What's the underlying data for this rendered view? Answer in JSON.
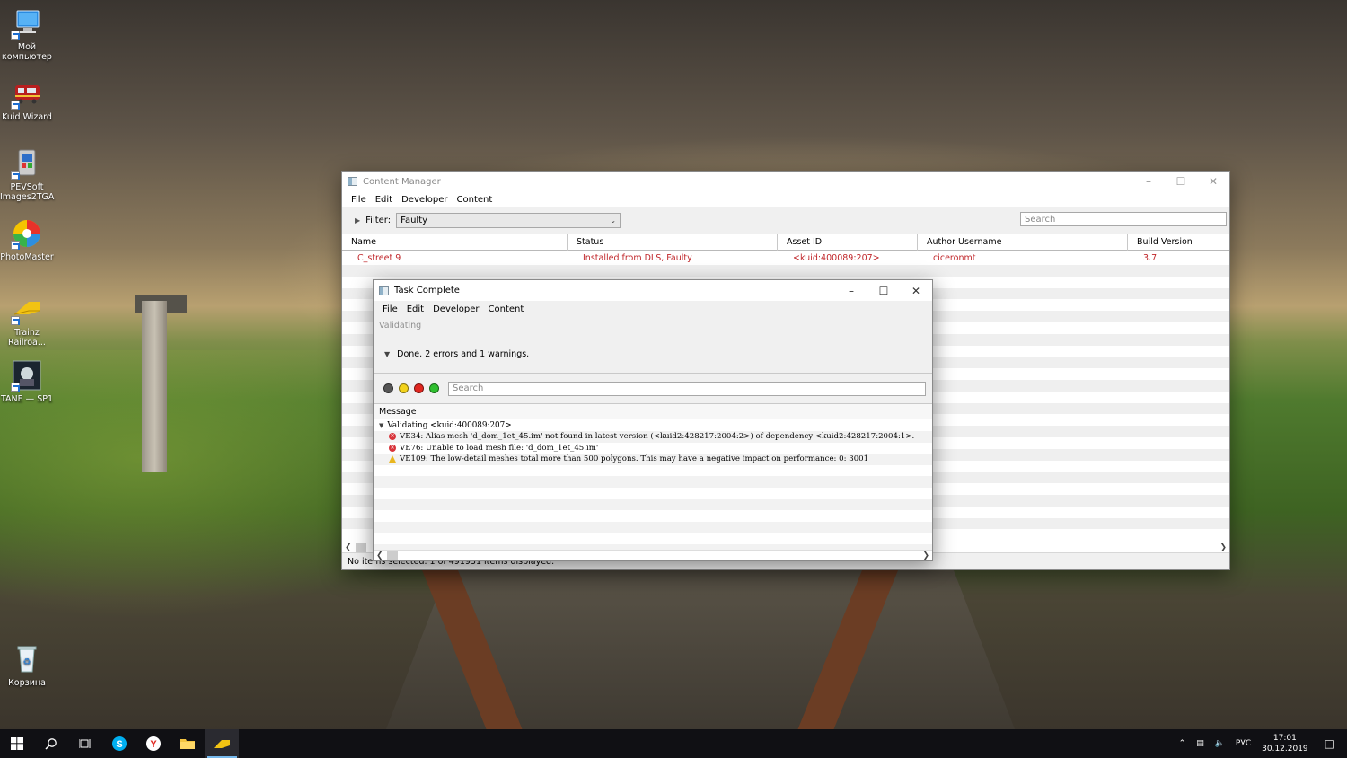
{
  "desktop": {
    "icons": [
      {
        "label": "Мой компьютер",
        "icon": "computer-icon"
      },
      {
        "label": "Kuid Wizard",
        "icon": "train-icon"
      },
      {
        "label": "PEVSoft Images2TGA",
        "icon": "converter-icon"
      },
      {
        "label": "PhotoMaster",
        "icon": "color-wheel-icon"
      },
      {
        "label": "Trainz Railroa...",
        "icon": "trainz-icon"
      },
      {
        "label": "TANE — SP1",
        "icon": "tane-icon"
      },
      {
        "label": "Корзина",
        "icon": "recycle-bin-icon"
      }
    ]
  },
  "content_manager": {
    "title": "Content Manager",
    "menu": [
      "File",
      "Edit",
      "Developer",
      "Content"
    ],
    "filter_label": "Filter:",
    "filter_value": "Faulty",
    "search_placeholder": "Search",
    "columns": [
      "Name",
      "Status",
      "Asset ID",
      "Author Username",
      "Build Version"
    ],
    "rows": [
      {
        "name": "C_street 9",
        "status": "Installed from DLS, Faulty",
        "asset_id": "<kuid:400089:207>",
        "author": "ciceronmt",
        "build": "3.7"
      }
    ],
    "status_bar": "No items selected. 1 of 491931 items displayed."
  },
  "task_complete": {
    "title": "Task Complete",
    "menu": [
      "File",
      "Edit",
      "Developer",
      "Content"
    ],
    "validating_label": "Validating",
    "done_text": "Done. 2 errors and 1 warnings.",
    "search_placeholder": "Search",
    "message_header": "Message",
    "tree_root": "Validating <kuid:400089:207>",
    "messages": [
      {
        "type": "error",
        "text": "VE34: Alias mesh 'd_dom_1et_45.im' not found in latest version (<kuid2:428217:2004:2>) of dependency <kuid2:428217:2004:1>."
      },
      {
        "type": "error",
        "text": "VE76: Unable to load mesh file: 'd_dom_1et_45.im'"
      },
      {
        "type": "warning",
        "text": "VE109: The low-detail meshes total more than 500 polygons. This may have a negative impact on performance: 0: 3001"
      }
    ],
    "filter_dot_colors": [
      "#555555",
      "#f2d21b",
      "#e0261f",
      "#2fbf2f"
    ]
  },
  "taskbar": {
    "language": "РУС",
    "time": "17:01",
    "date": "30.12.2019"
  }
}
